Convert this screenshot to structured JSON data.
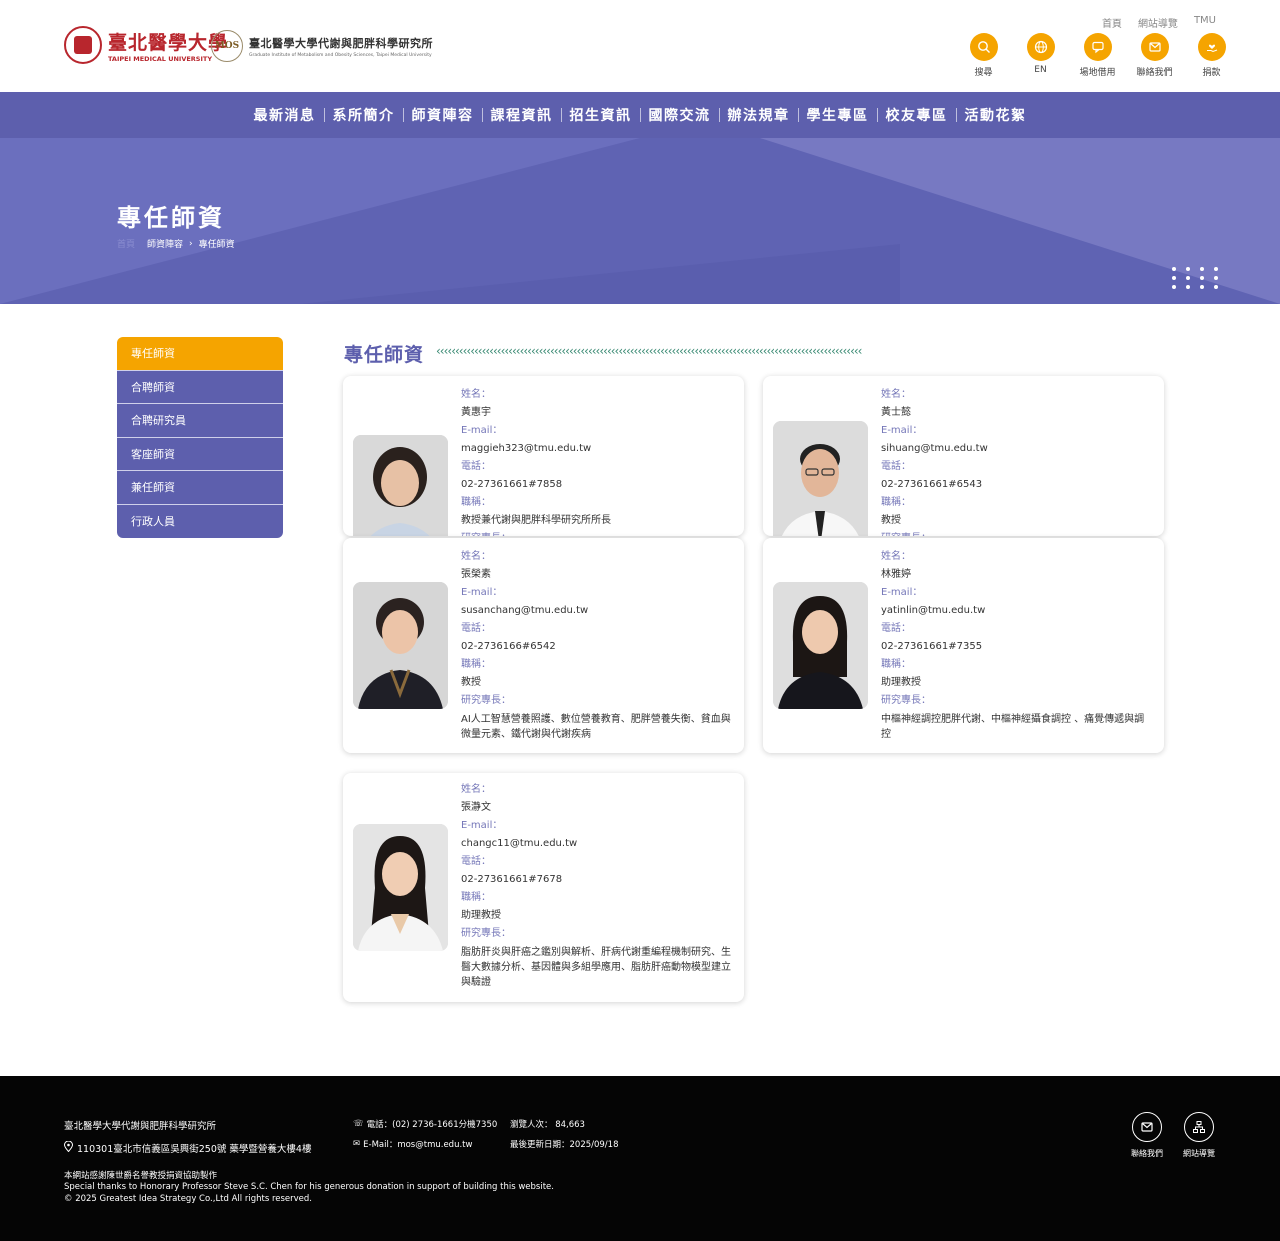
{
  "header": {
    "tmu_name_cn": "臺北醫學大學",
    "tmu_name_en": "TAIPEI MEDICAL UNIVERSITY",
    "inst_seal": "MOS",
    "inst_name_cn": "臺北醫學大學代謝與肥胖科學研究所",
    "inst_name_en": "Graduate Institute of Metabolism and Obesity Sciences, Taipei Medical University",
    "toplinks": [
      "首頁",
      "網站導覽",
      "TMU"
    ],
    "quick": [
      {
        "label": "搜尋",
        "icon": "search-icon"
      },
      {
        "label": "EN",
        "icon": "globe-icon"
      },
      {
        "label": "場地借用",
        "icon": "chat-icon"
      },
      {
        "label": "聯絡我們",
        "icon": "mail-icon"
      },
      {
        "label": "捐款",
        "icon": "donate-icon"
      }
    ],
    "accent": "#f5a400"
  },
  "nav": [
    "最新消息",
    "系所簡介",
    "師資陣容",
    "課程資訊",
    "招生資訊",
    "國際交流",
    "辦法規章",
    "學生專區",
    "校友專區",
    "活動花絮"
  ],
  "banner": {
    "title": "專任師資",
    "breadcrumb": [
      "首頁",
      "師資陣容",
      "專任師資"
    ],
    "color": "#5d5fad"
  },
  "sidebar": [
    "專任師資",
    "合聘師資",
    "合聘研究員",
    "客座師資",
    "兼任師資",
    "行政人員"
  ],
  "content": {
    "title": "專任師資"
  },
  "labels": {
    "name": "姓名：",
    "email": "E-mail：",
    "phone": "電話：",
    "title": "職稱：",
    "expertise": "研究專長："
  },
  "faculty": [
    {
      "name": "黃惠宇",
      "email": "maggieh323@tmu.edu.tw",
      "phone": "02-27361661#7858",
      "title": "教授兼代謝與肥胖科學研究所所長",
      "expertise": ""
    },
    {
      "name": "黃士懿",
      "email": "sihuang@tmu.edu.tw",
      "phone": "02-27361661#6543",
      "title": "教授",
      "expertise": ""
    },
    {
      "name": "張榮素",
      "email": "susanchang@tmu.edu.tw",
      "phone": "02-2736166#6542",
      "title": "教授",
      "expertise": "AI人工智慧營養照護、數位營養教育、肥胖營養失衡、貧血與微量元素、鐵代謝與代謝疾病"
    },
    {
      "name": "林雅婷",
      "email": "yatinlin@tmu.edu.tw",
      "phone": "02-27361661#7355",
      "title": "助理教授",
      "expertise": "中樞神經調控肥胖代謝、中樞神經攝食調控 、痛覺傳遞與調控"
    },
    {
      "name": "張瀞文",
      "email": "changc11@tmu.edu.tw",
      "phone": "02-27361661#7678",
      "title": "助理教授",
      "expertise": "脂肪肝炎與肝癌之鑑別與解析、肝病代謝重編程機制研究、生醫大數據分析、基因體與多組學應用、脂肪肝癌動物模型建立與驗證"
    }
  ],
  "footer": {
    "inst": "臺北醫學大學代謝與肥胖科學研究所",
    "address": "110301臺北市信義區吳興街250號 藥學暨營養大樓4樓",
    "phone": "電話：(02) 2736-1661分機7350",
    "email": "E-Mail：mos@tmu.edu.tw",
    "visitors": "瀏覽人次： 84,663",
    "updated": "最後更新日期：2025/09/18",
    "credit_cn": "本網站感謝陳世爵名譽教授捐資協助製作",
    "credit_en": "Special thanks to Honorary Professor Steve S.C. Chen for his generous donation in support of building this website.",
    "copyright": "© 2025 Greatest Idea Strategy Co.,Ltd All rights reserved.",
    "contact_label": "聯絡我們",
    "sitemap_label": "網站導覽"
  }
}
